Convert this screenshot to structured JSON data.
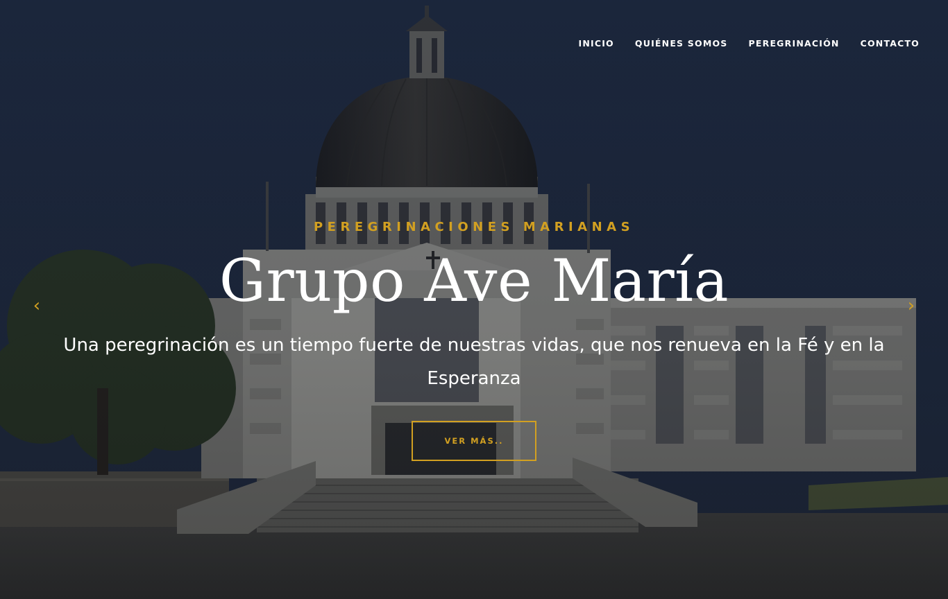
{
  "nav": {
    "items": [
      {
        "label": "INICIO"
      },
      {
        "label": "QUIÉNES SOMOS"
      },
      {
        "label": "PEREGRINACIÓN"
      },
      {
        "label": "CONTACTO"
      }
    ]
  },
  "hero": {
    "eyebrow": "PEREGRINACIONES MARIANAS",
    "title": "Grupo Ave María",
    "subtitle": "Una peregrinación es un tiempo fuerte de nuestras vidas, que nos renueva en la Fé y en la Esperanza",
    "cta_label": "VER MÁS..",
    "prev_icon": "‹",
    "next_icon": "›"
  },
  "colors": {
    "accent": "#d2a021",
    "text": "#ffffff",
    "sky": "#1e2a40"
  }
}
